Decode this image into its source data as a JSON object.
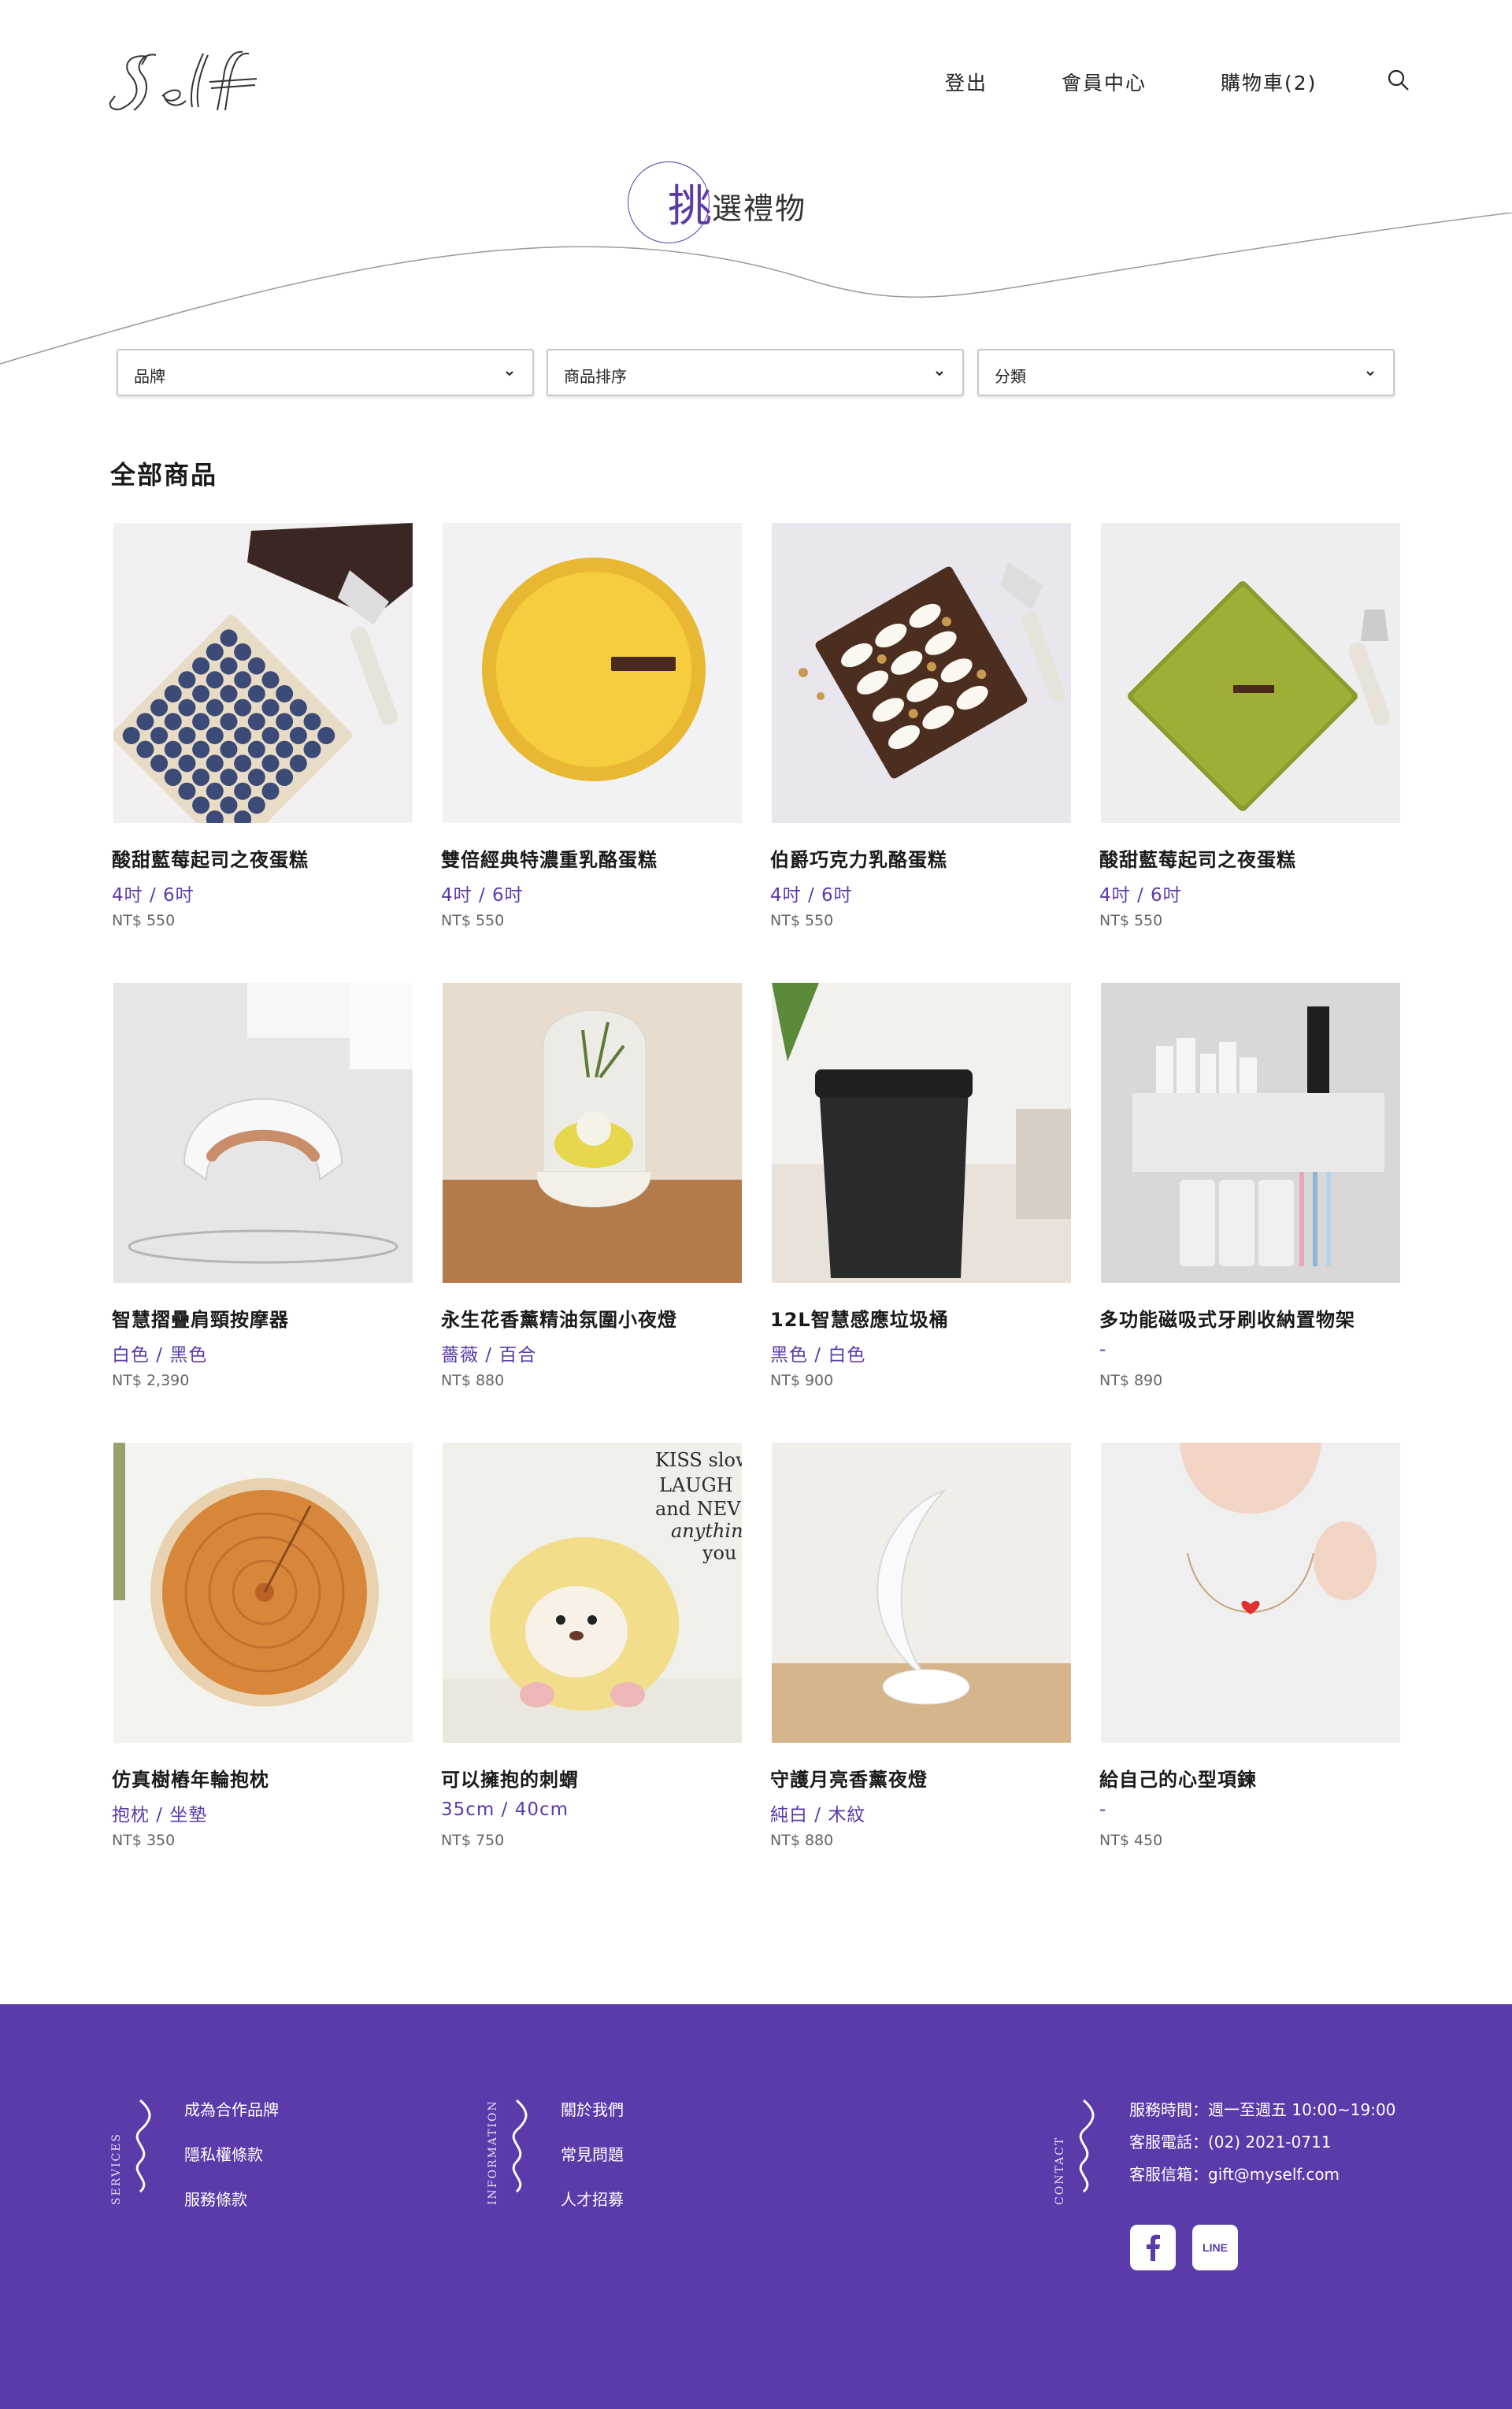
{
  "header": {
    "logo_text": "Self",
    "nav": {
      "logout": "登出",
      "member": "會員中心",
      "cart": "購物車(2)"
    }
  },
  "hero": {
    "title_first": "挑",
    "title_rest": "選禮物"
  },
  "filters": [
    {
      "label": "品牌"
    },
    {
      "label": "商品排序"
    },
    {
      "label": "分類"
    }
  ],
  "section_title": "全部商品",
  "products": [
    {
      "name": "酸甜藍莓起司之夜蛋糕",
      "spec": "4吋 / 6吋",
      "price": "NT$ 550"
    },
    {
      "name": "雙倍經典特濃重乳酪蛋糕",
      "spec": "4吋 / 6吋",
      "price": "NT$ 550"
    },
    {
      "name": "伯爵巧克力乳酪蛋糕",
      "spec": "4吋 / 6吋",
      "price": "NT$ 550"
    },
    {
      "name": "酸甜藍莓起司之夜蛋糕",
      "spec": "4吋 / 6吋",
      "price": "NT$ 550"
    },
    {
      "name": "智慧摺疊肩頸按摩器",
      "spec": "白色 / 黑色",
      "price": "NT$ 2,390"
    },
    {
      "name": "永生花香薰精油氛圍小夜燈",
      "spec": "薔薇 / 百合",
      "price": "NT$ 880"
    },
    {
      "name": "12L智慧感應垃圾桶",
      "spec": "黑色 / 白色",
      "price": "NT$ 900"
    },
    {
      "name": "多功能磁吸式牙刷收納置物架",
      "spec": "-",
      "price": "NT$ 890"
    },
    {
      "name": "仿真樹樁年輪抱枕",
      "spec": "抱枕 / 坐墊",
      "price": "NT$ 350"
    },
    {
      "name": "可以擁抱的刺蝟",
      "spec": "35cm / 40cm",
      "price": "NT$ 750"
    },
    {
      "name": "守護月亮香薰夜燈",
      "spec": "純白 / 木紋",
      "price": "NT$ 880"
    },
    {
      "name": "給自己的心型項鍊",
      "spec": "-",
      "price": "NT$ 450"
    }
  ],
  "footer": {
    "services": {
      "title": "SERVICES",
      "links": [
        "成為合作品牌",
        "隱私權條款",
        "服務條款"
      ]
    },
    "information": {
      "title": "INFORMATION",
      "links": [
        "關於我們",
        "常見問題",
        "人才招募"
      ]
    },
    "contact": {
      "title": "CONTACT",
      "lines": [
        "服務時間：週一至週五 10:00~19:00",
        "客服電話：(02) 2021-0711",
        "客服信箱：gift@myself.com"
      ]
    },
    "social": {
      "line_label": "LINE"
    }
  },
  "colors": {
    "brand": "#5b3aaa",
    "text": "#222222",
    "price": "#666666"
  },
  "icons": [
    "search-icon",
    "chevron-down-icon",
    "facebook-icon",
    "line-icon"
  ]
}
